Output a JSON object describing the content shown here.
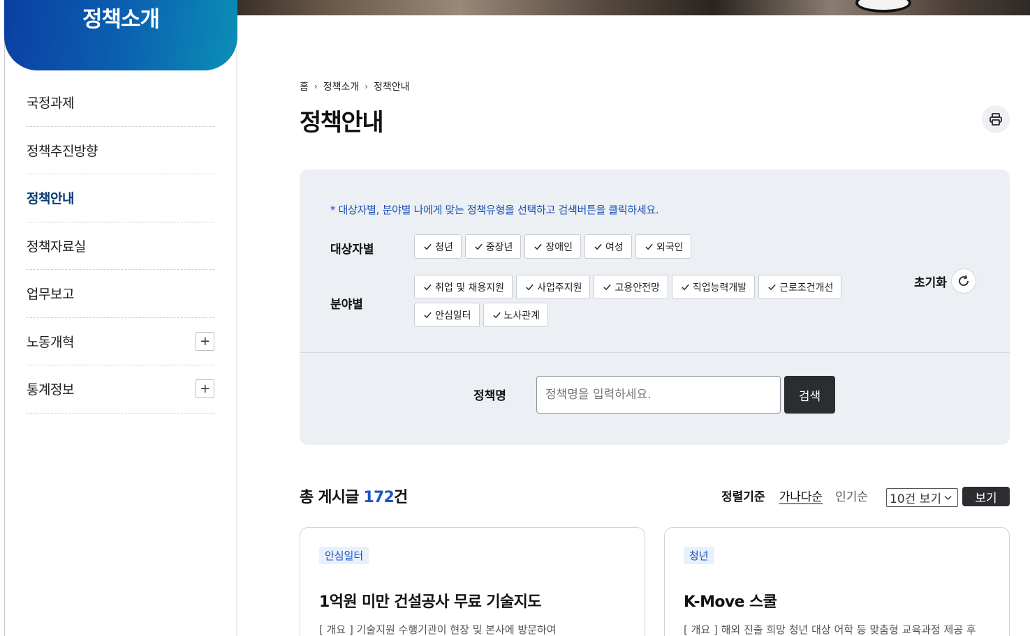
{
  "sidebar": {
    "title": "정책소개",
    "items": [
      {
        "label": "국정과제",
        "has_toggle": false
      },
      {
        "label": "정책추진방향",
        "has_toggle": false
      },
      {
        "label": "정책안내",
        "has_toggle": false,
        "active": true
      },
      {
        "label": "정책자료실",
        "has_toggle": false
      },
      {
        "label": "업무보고",
        "has_toggle": false
      },
      {
        "label": "노동개혁",
        "has_toggle": true
      },
      {
        "label": "통계정보",
        "has_toggle": true
      }
    ],
    "toggle_symbol": "+"
  },
  "breadcrumb": {
    "home": "홈",
    "level1": "정책소개",
    "level2": "정책안내",
    "separator": "›"
  },
  "page": {
    "title": "정책안내",
    "print_icon": "printer-icon"
  },
  "filter": {
    "guide": "* 대상자별, 분야별 나에게 맞는 정책유형을 선택하고 검색버튼을 클릭하세요.",
    "target_label": "대상자별",
    "target_chips": [
      "청년",
      "중장년",
      "장애인",
      "여성",
      "외국인"
    ],
    "field_label": "분야별",
    "field_chips": [
      "취업 및 채용지원",
      "사업주지원",
      "고용안전망",
      "직업능력개발",
      "근로조건개선",
      "안심일터",
      "노사관계"
    ],
    "reset_label": "초기화",
    "search_label": "정책명",
    "search_placeholder": "정책명을 입력하세요.",
    "search_value": "",
    "search_button": "검색"
  },
  "list": {
    "total_prefix": "총 게시글 ",
    "total_count": "172",
    "total_suffix": "건",
    "sort_label": "정렬기준",
    "sort_options": [
      "가나다순",
      "인기순"
    ],
    "view_select": "10건 보기",
    "view_button": "보기"
  },
  "cards": [
    {
      "tag": "안심일터",
      "title": "1억원 미만 건설공사 무료 기술지도",
      "desc": "[ 개요 ] 기술지원 수행기관이 현장 및 본사에 방문하여"
    },
    {
      "tag": "청년",
      "title": "K-Move 스쿨",
      "desc": "[ 개요 ] 해외 진출 희망 청년 대상 어학 등 맞춤형 교육과정 제공 후"
    }
  ],
  "colors": {
    "brand_blue": "#0a3fa3",
    "accent_teal": "#0b8fb6",
    "active_menu": "#0b3d73",
    "highlight_blue": "#1a56c2",
    "dark_button": "#2b2d31",
    "filter_bg": "#eceff3"
  }
}
